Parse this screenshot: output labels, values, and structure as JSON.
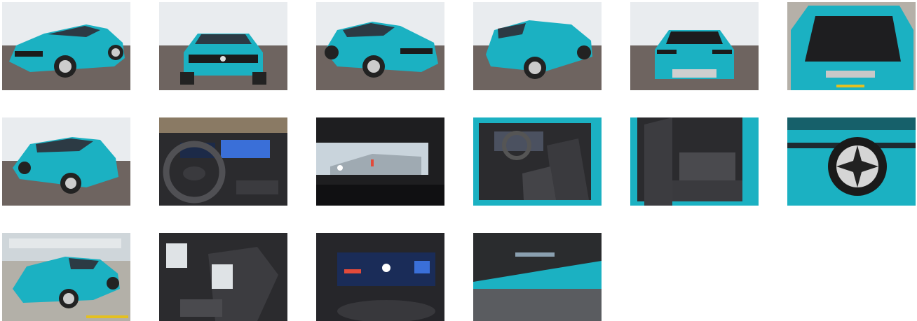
{
  "gallery": {
    "photos": [
      {
        "view": "front-left-three-quarter"
      },
      {
        "view": "front"
      },
      {
        "view": "front-right-three-quarter"
      },
      {
        "view": "rear-right-three-quarter"
      },
      {
        "view": "rear"
      },
      {
        "view": "open-trunk"
      },
      {
        "view": "rear-left-three-quarter"
      },
      {
        "view": "dashboard-steering-wheel"
      },
      {
        "view": "infotainment-screen"
      },
      {
        "view": "front-seats-interior"
      },
      {
        "view": "rear-seats-interior"
      },
      {
        "view": "wheel-closeup"
      },
      {
        "view": "front-left-in-garage"
      },
      {
        "view": "seat-and-center-console"
      },
      {
        "view": "instrument-cluster"
      },
      {
        "view": "windshield-vin-plate"
      }
    ]
  },
  "colors": {
    "car_body": "#1bb1c2",
    "studio_wall": "#e9ecef",
    "studio_floor": "#6e6460",
    "interior_dark": "#2b2b2e",
    "screen_blue": "#3a6fd8"
  }
}
